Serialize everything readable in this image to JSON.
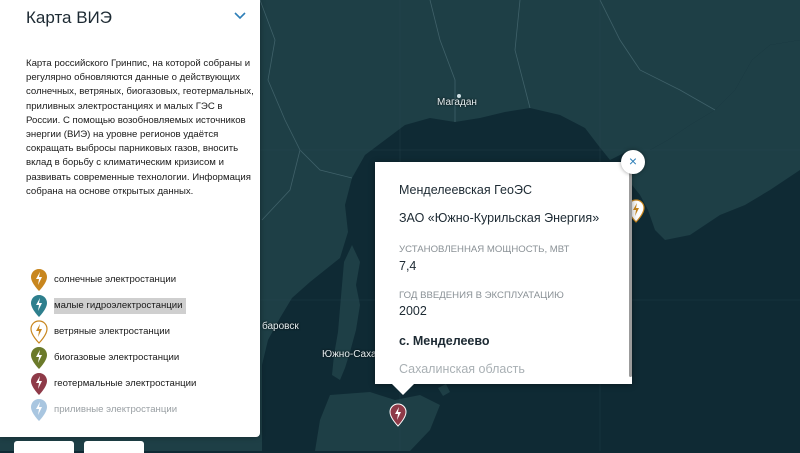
{
  "panel": {
    "title": "Карта ВИЭ",
    "description": "Карта российского Гринпис, на которой собраны и регулярно обновляются данные о действующих солнечных, ветряных, биогазовых, геотермальных, приливных электростанциях и малых ГЭС в России. С помощью возобновляемых источников энергии (ВИЭ) на уровне регионов удаётся сокращать выбросы парниковых газов, вносить вклад в борьбу с климатическим кризисом и развивать современные технологии. Информация собрана на основе открытых данных.",
    "legend": [
      {
        "label": "солнечные электростанции",
        "color": "#c8861e",
        "icon": "bolt-pin-solar-icon"
      },
      {
        "label": "малые гидроэлектростанции",
        "color": "#2e7f8d",
        "icon": "bolt-pin-hydro-icon"
      },
      {
        "label": "ветряные электростанции",
        "color": "#ffffff",
        "icon": "bolt-pin-wind-icon"
      },
      {
        "label": "биогазовые электростанции",
        "color": "#6b7a2a",
        "icon": "bolt-pin-biogas-icon"
      },
      {
        "label": "геотермальные электростанции",
        "color": "#8e3a48",
        "icon": "bolt-pin-geothermal-icon"
      },
      {
        "label": "приливные электростанции",
        "color": "#a9c6e0",
        "icon": "bolt-pin-tidal-icon"
      }
    ]
  },
  "map": {
    "cities": [
      {
        "name": "Магадан"
      },
      {
        "name": "баровск"
      },
      {
        "name": "Южно-Саха"
      }
    ]
  },
  "popup": {
    "name": "Менделеевская ГеоЭС",
    "owner": "ЗАО «Южно-Курильская Энергия»",
    "capacity_label": "УСТАНОВЛЕННАЯ МОЩНОСТЬ, МВТ",
    "capacity_value": "7,4",
    "year_label": "ГОД ВВЕДЕНИЯ В ЭКСПЛУАТАЦИЮ",
    "year_value": "2002",
    "location": "с. Менделеево",
    "region": "Сахалинская область",
    "close_symbol": "×"
  },
  "colors": {
    "sea": "#0f2a34",
    "land": "#1e3f46",
    "border": "#3f6169"
  }
}
